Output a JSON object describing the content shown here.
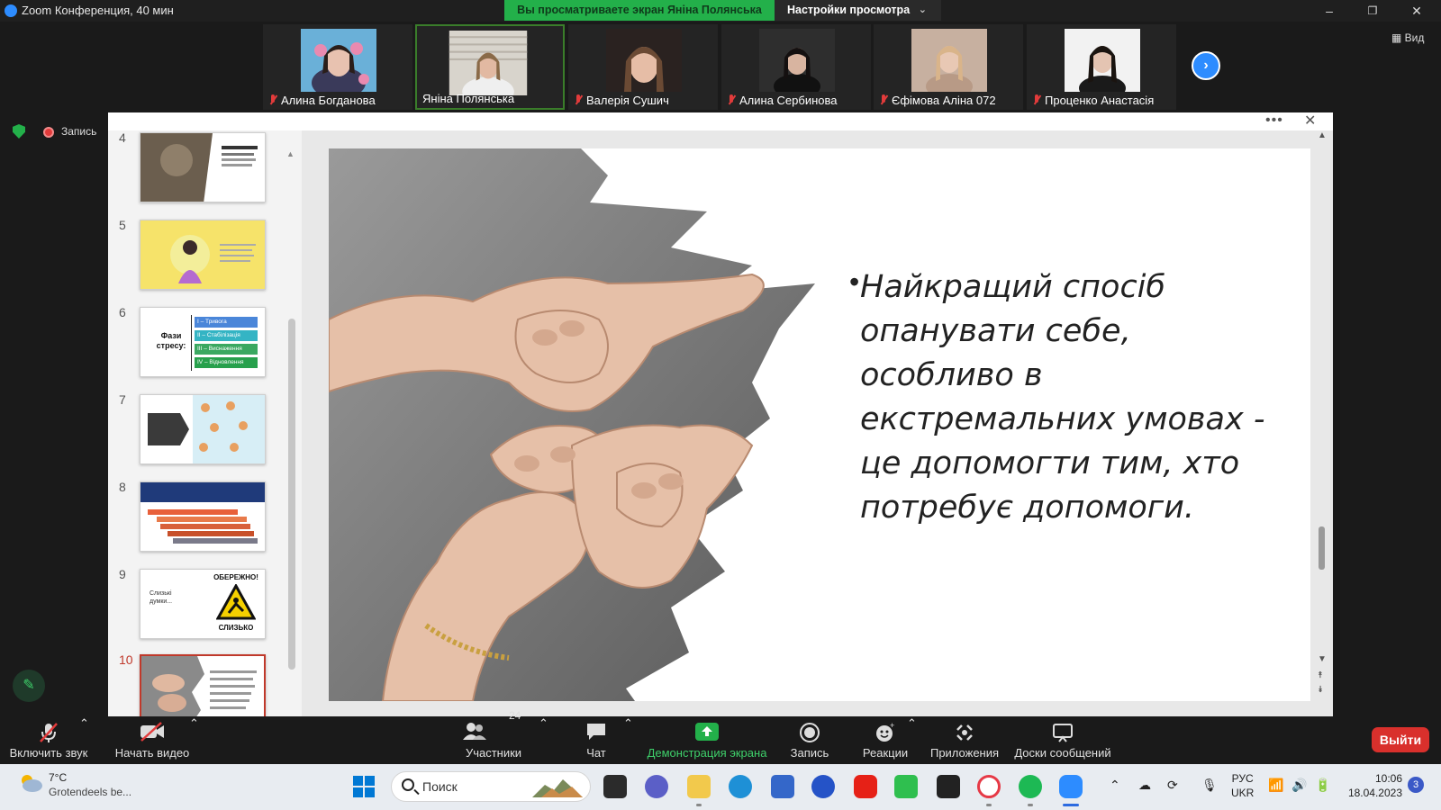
{
  "window": {
    "title": "Zoom Конференция, 40 мин",
    "share_banner": "Вы просматриваете экран Яніна Полянська",
    "view_settings": "Настройки просмотра",
    "view_button": "Вид"
  },
  "participants": [
    {
      "name": "Алина Богданова",
      "muted": true
    },
    {
      "name": "Яніна Полянська",
      "muted": false,
      "active": true
    },
    {
      "name": "Валерія Сушич",
      "muted": true
    },
    {
      "name": "Алина Сербинова",
      "muted": true
    },
    {
      "name": "Єфімова Аліна 072",
      "muted": true
    },
    {
      "name": "Проценко Анастасія",
      "muted": true
    }
  ],
  "recording_label": "Запись",
  "slides_panel": {
    "numbers": [
      "4",
      "5",
      "6",
      "7",
      "8",
      "9",
      "10"
    ],
    "selected": "10",
    "thumb_texts": {
      "s6_title": "Фази стресу:",
      "s6_items": [
        "I – Тривога",
        "II – Стабілізація",
        "III – Виснаження",
        "IV – Відновлення"
      ],
      "s9_warning": "ОБЕРЕЖНО!",
      "s9_slippery": "СЛИЗЬКО",
      "s9_left": "Слизькі думки..."
    }
  },
  "slide": {
    "text": "Найкращий спосіб опанувати себе, особливо в екстремальних умовах - це допомогти тим, хто потребує допомоги."
  },
  "toolbar": {
    "unmute": "Включить звук",
    "start_video": "Начать видео",
    "participants": "Участники",
    "participants_count": "24",
    "chat": "Чат",
    "share_screen": "Демонстрация экрана",
    "record": "Запись",
    "reactions": "Реакции",
    "apps": "Приложения",
    "whiteboards": "Доски сообщений",
    "leave": "Выйти"
  },
  "taskbar": {
    "weather_temp": "7°C",
    "weather_desc": "Grotendeels be...",
    "search_placeholder": "Поиск",
    "lang_top": "РУС",
    "lang_bottom": "UKR",
    "time": "10:06",
    "date": "18.04.2023",
    "notifications": "3"
  },
  "colors": {
    "zoom_blue": "#2d8cff",
    "share_green": "#23b04a",
    "leave_red": "#d9302c"
  }
}
